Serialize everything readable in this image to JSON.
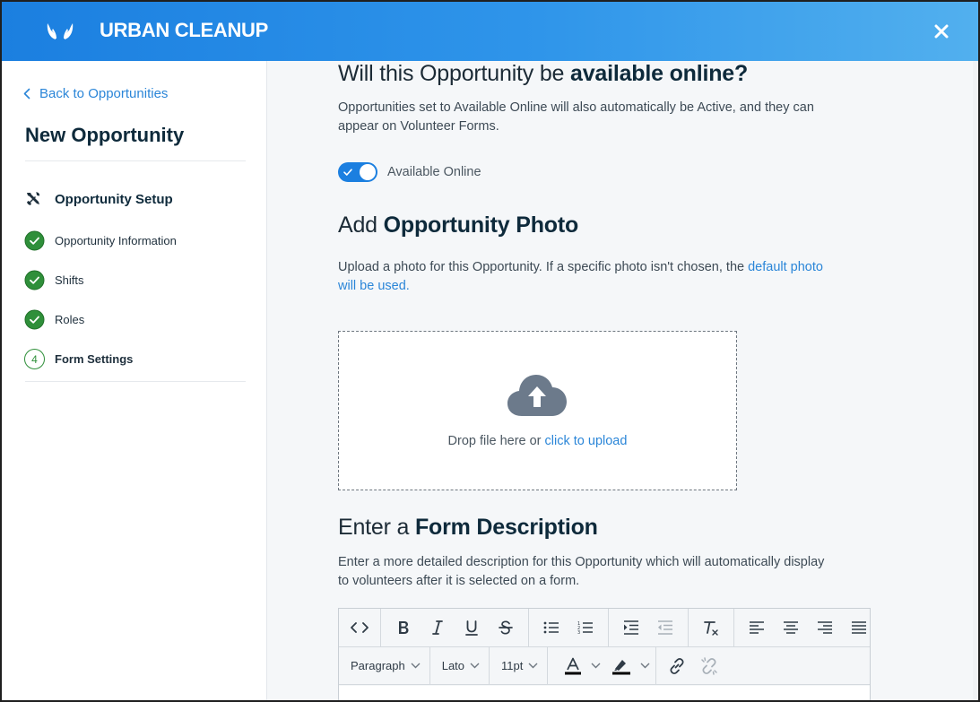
{
  "header": {
    "brand": "URBAN CLEANUP",
    "logo_icon": "hands-logo-icon",
    "close_icon": "close-icon"
  },
  "sidebar": {
    "back_label": "Back to Opportunities",
    "title": "New Opportunity",
    "section_heading": "Opportunity Setup",
    "steps": [
      {
        "label": "Opportunity Information",
        "status": "complete"
      },
      {
        "label": "Shifts",
        "status": "complete"
      },
      {
        "label": "Roles",
        "status": "complete"
      },
      {
        "label": "Form Settings",
        "status": "current",
        "number": "4"
      }
    ]
  },
  "main": {
    "online": {
      "heading_prefix": "Will this Opportunity be",
      "heading_bold": "available online?",
      "description": "Opportunities set to Available Online will also automatically be Active, and they can appear on Volunteer Forms.",
      "toggle_label": "Available Online",
      "toggle_on": true
    },
    "photo": {
      "heading_prefix": "Add",
      "heading_bold": "Opportunity Photo",
      "description": "Upload a photo for this Opportunity. If a specific photo isn't chosen, the",
      "description_link": "default photo will be used.",
      "drop_text": "Drop file here or",
      "drop_link": "click to upload"
    },
    "form_description": {
      "heading_prefix": "Enter a",
      "heading_bold": "Form Description",
      "description": "Enter a more detailed description for this Opportunity which will automatically display to volunteers after it is selected on a form."
    },
    "editor": {
      "block_format": "Paragraph",
      "font_family": "Lato",
      "font_size": "11pt"
    }
  },
  "colors": {
    "header_start": "#1b7fe0",
    "header_end": "#52b0ee",
    "link": "#2b86d8",
    "success": "#2f8f3a",
    "heading": "#0e2a3b"
  }
}
